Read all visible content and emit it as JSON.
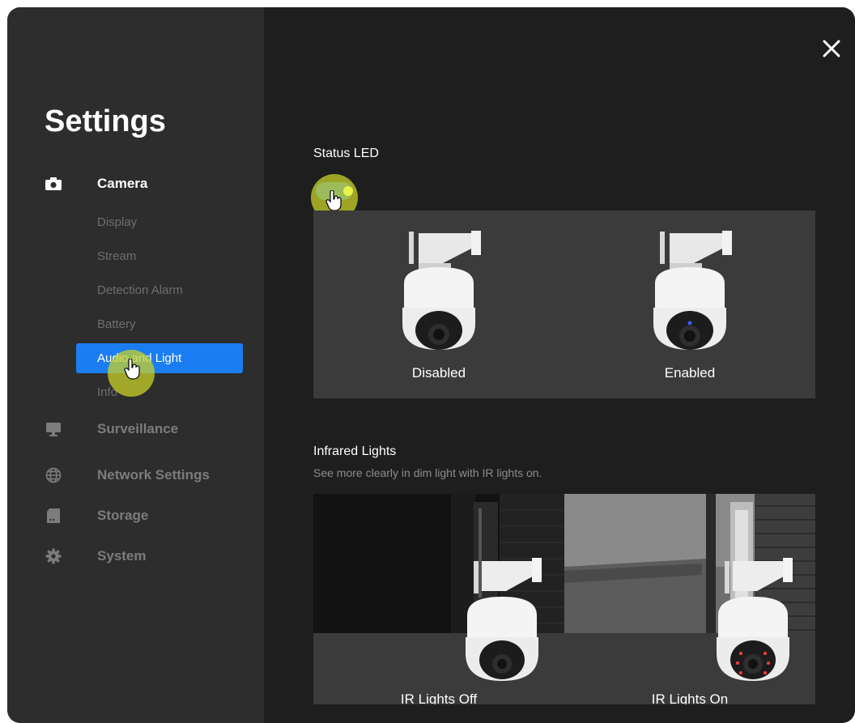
{
  "sidebar": {
    "title": "Settings",
    "sections": {
      "camera": "Camera",
      "surveillance": "Surveillance",
      "network": "Network Settings",
      "storage": "Storage",
      "system": "System"
    },
    "camera_items": {
      "display": "Display",
      "stream": "Stream",
      "detection": "Detection Alarm",
      "battery": "Battery",
      "audio_light": "Audio and Light",
      "info": "Info"
    },
    "selected_item": "Audio and Light",
    "icons": [
      "camera-icon",
      "monitor-icon",
      "globe-icon",
      "storage-icon",
      "gear-icon"
    ]
  },
  "main": {
    "status_led": {
      "title": "Status LED",
      "toggle_on": true,
      "disabled_label": "Disabled",
      "enabled_label": "Enabled"
    },
    "infrared": {
      "title": "Infrared Lights",
      "subtitle": "See more clearly in dim light with IR lights on.",
      "off_label": "IR Lights Off",
      "on_label": "IR Lights On"
    }
  },
  "colors": {
    "accent": "#1a7ef2",
    "sidebar_bg": "#2d2d2d",
    "main_bg": "#1e1e1e",
    "panel_bg": "#3b3b3b"
  },
  "close_icon": "close-icon"
}
